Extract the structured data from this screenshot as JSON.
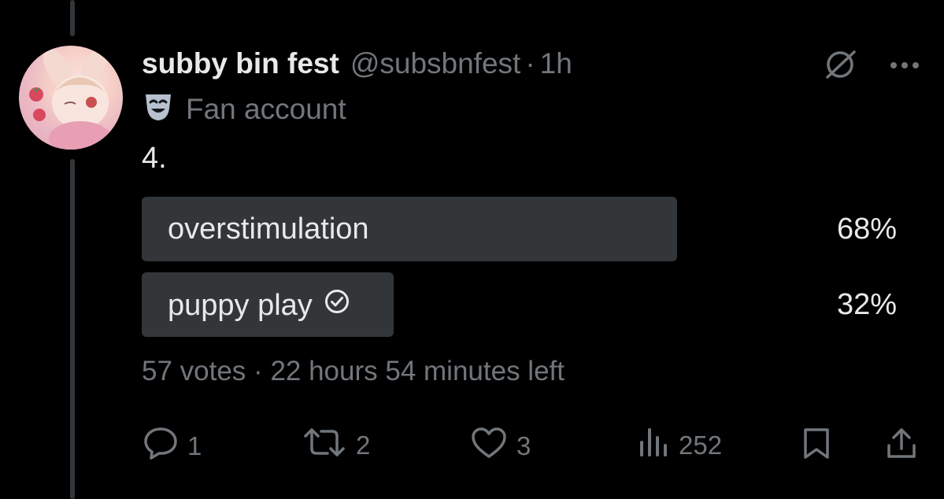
{
  "tweet": {
    "display_name": "subby bin fest",
    "handle": "@subsbnfest",
    "separator": "·",
    "time": "1h",
    "account_label": "Fan account",
    "text": "4."
  },
  "poll": {
    "options": [
      {
        "label": "overstimulation",
        "percent_text": "68%",
        "fraction": 0.68,
        "selected": false
      },
      {
        "label": "puppy play",
        "percent_text": "32%",
        "fraction": 0.32,
        "selected": true
      }
    ],
    "votes": "57 votes",
    "separator": "·",
    "time_left": "22 hours 54 minutes left"
  },
  "actions": {
    "replies": "1",
    "reposts": "2",
    "likes": "3",
    "views": "252"
  },
  "colors": {
    "background": "#000000",
    "text": "#e7e9ea",
    "muted": "#71767b",
    "poll_bar": "#333639"
  },
  "icons": [
    "grok-icon",
    "more-icon",
    "fan-account-mask-icon",
    "checkmark-circle-icon",
    "reply-icon",
    "repost-icon",
    "like-icon",
    "views-icon",
    "bookmark-icon",
    "share-icon"
  ]
}
